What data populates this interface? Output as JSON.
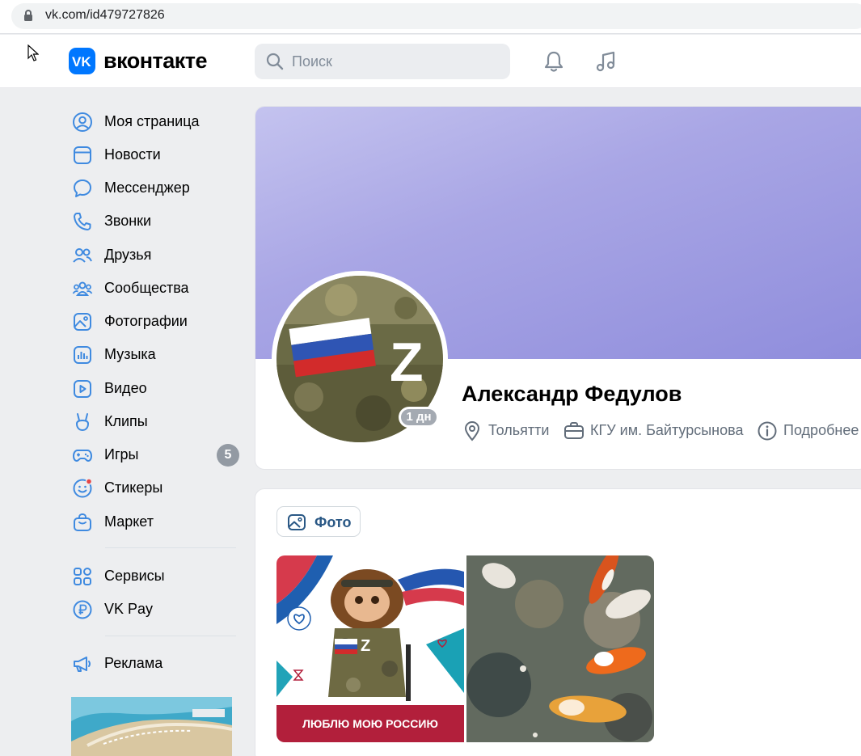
{
  "browser": {
    "url": "vk.com/id479727826"
  },
  "header": {
    "logo_text": "вконтакте",
    "search_placeholder": "Поиск"
  },
  "menu": {
    "items": [
      {
        "label": "Моя страница",
        "icon": "user-circle-icon"
      },
      {
        "label": "Новости",
        "icon": "newsfeed-icon"
      },
      {
        "label": "Мессенджер",
        "icon": "message-icon"
      },
      {
        "label": "Звонки",
        "icon": "phone-icon"
      },
      {
        "label": "Друзья",
        "icon": "friends-icon"
      },
      {
        "label": "Сообщества",
        "icon": "communities-icon"
      },
      {
        "label": "Фотографии",
        "icon": "photos-icon"
      },
      {
        "label": "Музыка",
        "icon": "music-bars-icon"
      },
      {
        "label": "Видео",
        "icon": "video-icon"
      },
      {
        "label": "Клипы",
        "icon": "clips-icon"
      },
      {
        "label": "Игры",
        "icon": "gamepad-icon",
        "badge": "5"
      },
      {
        "label": "Стикеры",
        "icon": "smile-icon"
      },
      {
        "label": "Маркет",
        "icon": "market-bag-icon"
      }
    ],
    "secondary": [
      {
        "label": "Сервисы",
        "icon": "services-grid-icon"
      },
      {
        "label": "VK Pay",
        "icon": "vkpay-ruble-icon"
      }
    ],
    "ads": {
      "label": "Реклама",
      "icon": "megaphone-icon"
    }
  },
  "profile": {
    "name": "Александр Федулов",
    "last_seen": "1 дн",
    "city": "Тольятти",
    "education": "КГУ им. Байтурсынова",
    "more": "Подробнее",
    "avatar_letter": "Z"
  },
  "photos": {
    "tab_label": "Фото",
    "caption": "ЛЮБЛЮ МОЮ РОССИЮ",
    "thumb_letter": "Z"
  },
  "colors": {
    "brand": "#0077ff",
    "link": "#2a5885",
    "caption_bg": "#b21f3b",
    "cover": "#a9a6e5"
  }
}
